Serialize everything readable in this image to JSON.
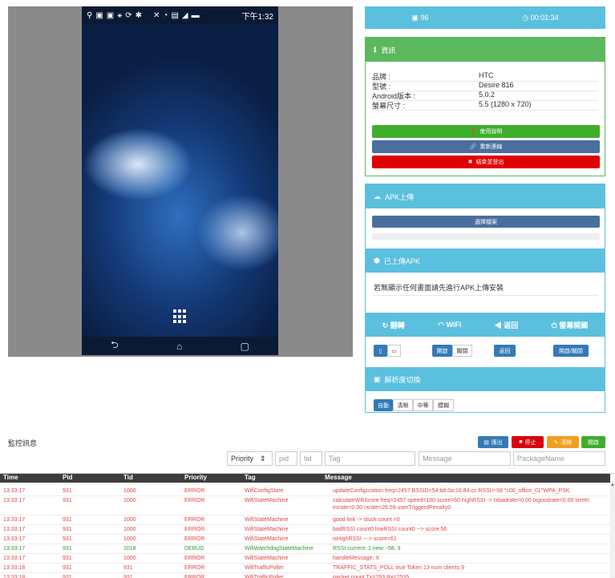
{
  "device": {
    "status": {
      "icons": [
        "location-icon",
        "app-icon-1",
        "app-icon-2",
        "usb-icon",
        "sync-icon",
        "debug-icon",
        "mute-icon",
        "wifi-icon",
        "sim-icon",
        "signal-icon",
        "battery-icon"
      ],
      "time": "下午1:32"
    },
    "nav": {
      "back": "⮌",
      "home": "⌂",
      "recent": "▢"
    }
  },
  "topbar": {
    "fps": "96",
    "timer": "00:01:34"
  },
  "info": {
    "title": "資訊",
    "rows": [
      {
        "k": "品牌 :",
        "v": "HTC"
      },
      {
        "k": "型號 :",
        "v": "Desire 816"
      },
      {
        "k": "Android版本 :",
        "v": "5.0.2"
      },
      {
        "k": "螢幕尺寸 :",
        "v": "5.5 (1280 x 720)"
      }
    ],
    "btn_help": "使用說明",
    "btn_reconnect": "重新連線",
    "btn_logout": "結束並登出"
  },
  "apk": {
    "title": "APK上傳",
    "choose": "選擇檔案",
    "uploaded_title": "已上傳APK",
    "uploaded_msg": "若無顯示任何畫面請先進行APK上傳安裝"
  },
  "controls": {
    "rotate": "翻轉",
    "wifi": "WiFi",
    "back": "返回",
    "screen": "螢幕開關",
    "open": "開啟",
    "close": "關閉",
    "back_btn": "返回",
    "toggle": "開啟/關閉"
  },
  "resolution": {
    "title": "解析度切換",
    "options": [
      "自動",
      "清晰",
      "中等",
      "模糊"
    ]
  },
  "monitor": {
    "title": "監控訊息",
    "export": "匯出",
    "stop": "停止",
    "clear": "清除",
    "on": "開啟",
    "filter_priority": "Priority",
    "filter_pid": "pid",
    "filter_tid": "tid",
    "filter_tag": "Tag",
    "filter_message": "Message",
    "filter_package": "PackageName"
  },
  "log": {
    "headers": {
      "time": "Time",
      "pid": "Pid",
      "tid": "Tid",
      "priority": "Priority",
      "tag": "Tag",
      "message": "Message"
    },
    "rows": [
      {
        "time": "13:33:17",
        "pid": "931",
        "tid": "1000",
        "priority": "ERROR",
        "tag": "WifiConfigStore",
        "msg": "updateConfiguration freq=2457 BSSID=54:b8:0a:16:84:cc RSSI=-58 \"c00_office_01\"WPA_PSK",
        "lvl": "err"
      },
      {
        "time": "13:33:17",
        "pid": "931",
        "tid": "1000",
        "priority": "ERROR",
        "tag": "WifiStateMachine",
        "msg": "calculateWifiScore freq=2457 speed=150 score=60 highRSSI -> txbadrate=0.00 txgoodrate=0.00 txretri",
        "msg2": "esrate=0.00 rxrate=26.59 userTriggerdPenalty0",
        "lvl": "err"
      },
      {
        "time": "13:33:17",
        "pid": "931",
        "tid": "1000",
        "priority": "ERROR",
        "tag": "WifiStateMachine",
        "msg": "good link -> stuck count =0",
        "lvl": "err"
      },
      {
        "time": "13:33:17",
        "pid": "931",
        "tid": "1000",
        "priority": "ERROR",
        "tag": "WifiStateMachine",
        "msg": "badRSSI count0 lowRSSI count0 --> score 56",
        "lvl": "err"
      },
      {
        "time": "13:33:17",
        "pid": "931",
        "tid": "1000",
        "priority": "ERROR",
        "tag": "WifiStateMachine",
        "msg": "isHighRSSI ---> score=61",
        "lvl": "err"
      },
      {
        "time": "13:33:17",
        "pid": "931",
        "tid": "1018",
        "priority": "DEBUG",
        "tag": "WifiWatchdogStateMachine",
        "msg": "RSSI current: 1 new: -58, 3",
        "lvl": "dbg"
      },
      {
        "time": "13:33:17",
        "pid": "931",
        "tid": "1000",
        "priority": "ERROR",
        "tag": "WifiStateMachine",
        "msg": "handleMessage: X",
        "lvl": "err"
      },
      {
        "time": "13:33:18",
        "pid": "931",
        "tid": "931",
        "priority": "ERROR",
        "tag": "WifiTrafficPoller",
        "msg": "TRAFFIC_STATS_POLL true Token 13 num clients 9",
        "lvl": "err"
      },
      {
        "time": "13:33:18",
        "pid": "931",
        "tid": "931",
        "priority": "ERROR",
        "tag": "WifiTrafficPoller",
        "msg": "packet count Tx=293 Rx=2535",
        "lvl": "err"
      }
    ]
  }
}
